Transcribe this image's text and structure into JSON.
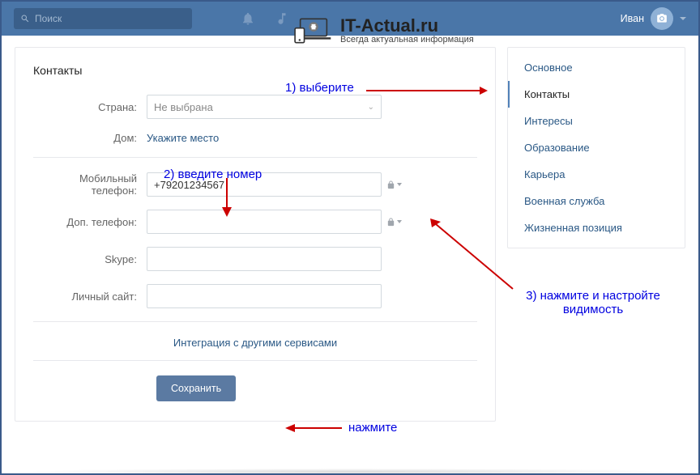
{
  "header": {
    "search_placeholder": "Поиск",
    "username": "Иван"
  },
  "watermark": {
    "title": "IT-Actual.ru",
    "subtitle": "Всегда актуальная информация"
  },
  "page": {
    "title": "Контакты"
  },
  "form": {
    "country_label": "Страна:",
    "country_placeholder": "Не выбрана",
    "home_label": "Дом:",
    "home_link": "Укажите место",
    "mobile_label": "Мобильный телефон:",
    "mobile_value": "+79201234567",
    "alt_phone_label": "Доп. телефон:",
    "alt_phone_value": "",
    "skype_label": "Skype:",
    "skype_value": "",
    "website_label": "Личный сайт:",
    "website_value": "",
    "integration_link": "Интеграция с другими сервисами",
    "save_button": "Сохранить"
  },
  "nav": {
    "items": [
      {
        "label": "Основное"
      },
      {
        "label": "Контакты"
      },
      {
        "label": "Интересы"
      },
      {
        "label": "Образование"
      },
      {
        "label": "Карьера"
      },
      {
        "label": "Военная служба"
      },
      {
        "label": "Жизненная позиция"
      }
    ],
    "active_index": 1
  },
  "annotations": {
    "a1": "1) выберите",
    "a2": "2) введите номер",
    "a3": "3) нажмите и настройте видимость",
    "a4": "нажмите"
  }
}
